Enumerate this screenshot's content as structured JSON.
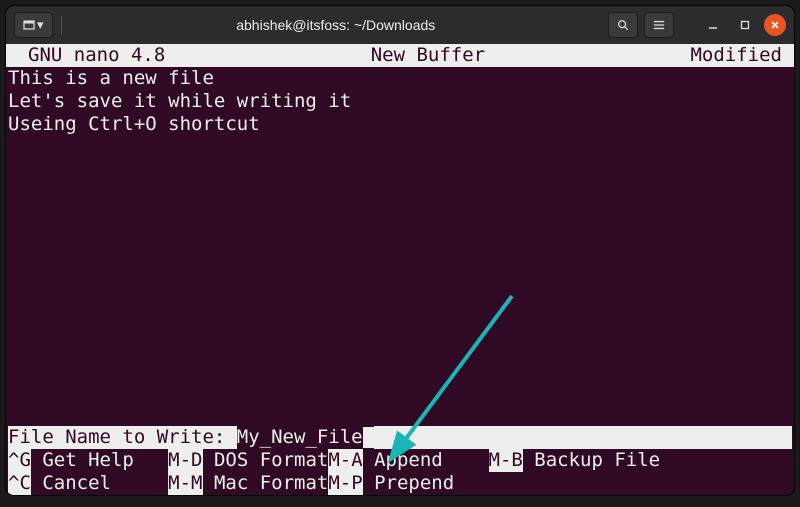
{
  "window": {
    "title": "abhishek@itsfoss: ~/Downloads"
  },
  "nano": {
    "app": "GNU nano 4.8",
    "buffer": "New Buffer",
    "status": "Modified",
    "lines": [
      "This is a new file",
      "Let's save it while writing it",
      "Useing Ctrl+O shortcut"
    ],
    "prompt_label": "File Name to Write: ",
    "filename": "My_New_File",
    "shortcuts": {
      "row1": [
        {
          "key": "^G",
          "label": " Get Help   "
        },
        {
          "key": "M-D",
          "label": " DOS Format"
        },
        {
          "key": "M-A",
          "label": " Append    "
        },
        {
          "key": "M-B",
          "label": " Backup File"
        }
      ],
      "row2": [
        {
          "key": "^C",
          "label": " Cancel     "
        },
        {
          "key": "M-M",
          "label": " Mac Format"
        },
        {
          "key": "M-P",
          "label": " Prepend"
        }
      ]
    }
  }
}
